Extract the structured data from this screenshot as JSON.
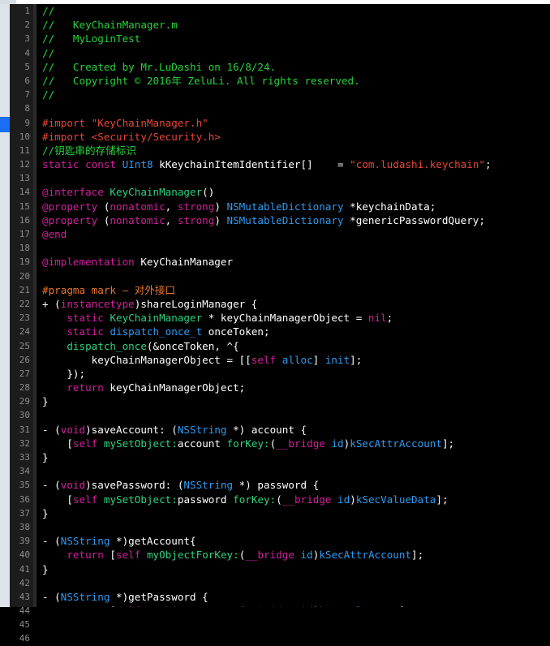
{
  "window": {
    "title": "KeyChainManager.m",
    "project": "MyLoginTest",
    "language": "Objective-C",
    "theme": "dark",
    "colors": {
      "background": "#000000",
      "gutter": "#1c1c1c",
      "line_number": "#8c8c8c",
      "ribbon": "#dfe4ea",
      "marker_blue": "#1a6ef5",
      "comment_green": "#29d13b",
      "preprocessor_red": "#e8463a",
      "string_red": "#e8463a",
      "keyword_magenta": "#d0219b",
      "type_blue": "#2f9bf0",
      "class_green": "#2ed17d",
      "selector_green": "#2ed17d",
      "pragma_orange": "#e8762a",
      "plain_white": "#ffffff"
    }
  },
  "gutter": {
    "line_numbers": [
      1,
      2,
      3,
      4,
      5,
      6,
      7,
      8,
      9,
      10,
      11,
      12,
      13,
      14,
      15,
      16,
      17,
      18,
      19,
      20,
      21,
      22,
      23,
      24,
      25,
      26,
      27,
      28,
      29,
      30,
      31,
      32,
      33,
      34,
      35,
      36,
      37,
      38,
      39,
      40,
      41,
      42,
      43,
      44,
      45,
      46
    ]
  },
  "code": {
    "lines": [
      {
        "n": 1,
        "tokens": [
          {
            "t": "//",
            "c": "t-com"
          }
        ]
      },
      {
        "n": 2,
        "tokens": [
          {
            "t": "//   KeyChainManager.m",
            "c": "t-com"
          }
        ]
      },
      {
        "n": 3,
        "tokens": [
          {
            "t": "//   MyLoginTest",
            "c": "t-com"
          }
        ]
      },
      {
        "n": 4,
        "tokens": [
          {
            "t": "//",
            "c": "t-com"
          }
        ]
      },
      {
        "n": 5,
        "tokens": [
          {
            "t": "//   Created by Mr.LuDashi on 16/8/24.",
            "c": "t-com"
          }
        ]
      },
      {
        "n": 6,
        "tokens": [
          {
            "t": "//   Copyright © 2016年 ZeluLi. All rights reserved.",
            "c": "t-com"
          }
        ]
      },
      {
        "n": 7,
        "tokens": [
          {
            "t": "//",
            "c": "t-com"
          }
        ]
      },
      {
        "n": 8,
        "tokens": []
      },
      {
        "n": 9,
        "tokens": [
          {
            "t": "#import ",
            "c": "t-pre"
          },
          {
            "t": "\"KeyChainManager.h\"",
            "c": "t-str"
          }
        ]
      },
      {
        "n": 10,
        "tokens": [
          {
            "t": "#import ",
            "c": "t-pre"
          },
          {
            "t": "<Security/Security.h>",
            "c": "t-str"
          }
        ]
      },
      {
        "n": 11,
        "tokens": [
          {
            "t": "//钥匙串的存储标识",
            "c": "t-com"
          }
        ]
      },
      {
        "n": 12,
        "tokens": [
          {
            "t": "static",
            "c": "t-kw"
          },
          {
            "t": " ",
            "c": "t-plain"
          },
          {
            "t": "const",
            "c": "t-kw"
          },
          {
            "t": " ",
            "c": "t-plain"
          },
          {
            "t": "UInt8",
            "c": "t-typ"
          },
          {
            "t": " kKeychainItemIdentifier[]    = ",
            "c": "t-plain"
          },
          {
            "t": "\"com.ludashi.keychain\"",
            "c": "t-str"
          },
          {
            "t": ";",
            "c": "t-plain"
          }
        ]
      },
      {
        "n": 13,
        "tokens": []
      },
      {
        "n": 14,
        "tokens": [
          {
            "t": "@interface",
            "c": "t-kw"
          },
          {
            "t": " ",
            "c": "t-plain"
          },
          {
            "t": "KeyChainManager",
            "c": "t-cls"
          },
          {
            "t": "()",
            "c": "t-plain"
          }
        ]
      },
      {
        "n": 15,
        "tokens": [
          {
            "t": "@property",
            "c": "t-kw"
          },
          {
            "t": " (",
            "c": "t-plain"
          },
          {
            "t": "nonatomic",
            "c": "t-kw"
          },
          {
            "t": ", ",
            "c": "t-plain"
          },
          {
            "t": "strong",
            "c": "t-kw"
          },
          {
            "t": ") ",
            "c": "t-plain"
          },
          {
            "t": "NSMutableDictionary",
            "c": "t-typ"
          },
          {
            "t": " *keychainData;",
            "c": "t-plain"
          }
        ]
      },
      {
        "n": 16,
        "tokens": [
          {
            "t": "@property",
            "c": "t-kw"
          },
          {
            "t": " (",
            "c": "t-plain"
          },
          {
            "t": "nonatomic",
            "c": "t-kw"
          },
          {
            "t": ", ",
            "c": "t-plain"
          },
          {
            "t": "strong",
            "c": "t-kw"
          },
          {
            "t": ") ",
            "c": "t-plain"
          },
          {
            "t": "NSMutableDictionary",
            "c": "t-typ"
          },
          {
            "t": " *genericPasswordQuery;",
            "c": "t-plain"
          }
        ]
      },
      {
        "n": 17,
        "tokens": [
          {
            "t": "@end",
            "c": "t-kw"
          }
        ]
      },
      {
        "n": 18,
        "tokens": []
      },
      {
        "n": 19,
        "tokens": [
          {
            "t": "@implementation",
            "c": "t-kw"
          },
          {
            "t": " KeyChainManager",
            "c": "t-plain"
          }
        ]
      },
      {
        "n": 20,
        "tokens": []
      },
      {
        "n": 21,
        "tokens": [
          {
            "t": "#pragma mark — 对外接口",
            "c": "t-prag"
          }
        ]
      },
      {
        "n": 22,
        "tokens": [
          {
            "t": "+ (",
            "c": "t-plain"
          },
          {
            "t": "instancetype",
            "c": "t-kw"
          },
          {
            "t": ")shareLoginManager {",
            "c": "t-plain"
          }
        ]
      },
      {
        "n": 23,
        "tokens": [
          {
            "t": "    ",
            "c": "t-plain"
          },
          {
            "t": "static",
            "c": "t-kw"
          },
          {
            "t": " ",
            "c": "t-plain"
          },
          {
            "t": "KeyChainManager",
            "c": "t-cls"
          },
          {
            "t": " * keyChainManagerObject = ",
            "c": "t-plain"
          },
          {
            "t": "nil",
            "c": "t-kw"
          },
          {
            "t": ";",
            "c": "t-plain"
          }
        ]
      },
      {
        "n": 24,
        "tokens": [
          {
            "t": "    ",
            "c": "t-plain"
          },
          {
            "t": "static",
            "c": "t-kw"
          },
          {
            "t": " ",
            "c": "t-plain"
          },
          {
            "t": "dispatch_once_t",
            "c": "t-typ"
          },
          {
            "t": " onceToken;",
            "c": "t-plain"
          }
        ]
      },
      {
        "n": 25,
        "tokens": [
          {
            "t": "    ",
            "c": "t-plain"
          },
          {
            "t": "dispatch_once",
            "c": "t-sel"
          },
          {
            "t": "(&onceToken, ^{",
            "c": "t-plain"
          }
        ]
      },
      {
        "n": 26,
        "tokens": [
          {
            "t": "        keyChainManagerObject = [[",
            "c": "t-plain"
          },
          {
            "t": "self",
            "c": "t-kw"
          },
          {
            "t": " ",
            "c": "t-plain"
          },
          {
            "t": "alloc",
            "c": "t-typ"
          },
          {
            "t": "] ",
            "c": "t-plain"
          },
          {
            "t": "init",
            "c": "t-typ"
          },
          {
            "t": "];",
            "c": "t-plain"
          }
        ]
      },
      {
        "n": 27,
        "tokens": [
          {
            "t": "    });",
            "c": "t-plain"
          }
        ]
      },
      {
        "n": 28,
        "tokens": [
          {
            "t": "    ",
            "c": "t-plain"
          },
          {
            "t": "return",
            "c": "t-kw"
          },
          {
            "t": " keyChainManagerObject;",
            "c": "t-plain"
          }
        ]
      },
      {
        "n": 29,
        "tokens": [
          {
            "t": "}",
            "c": "t-plain"
          }
        ]
      },
      {
        "n": 30,
        "tokens": []
      },
      {
        "n": 31,
        "tokens": [
          {
            "t": "- (",
            "c": "t-plain"
          },
          {
            "t": "void",
            "c": "t-kw"
          },
          {
            "t": ")saveAccount: (",
            "c": "t-plain"
          },
          {
            "t": "NSString",
            "c": "t-typ"
          },
          {
            "t": " *) account {",
            "c": "t-plain"
          }
        ]
      },
      {
        "n": 32,
        "tokens": [
          {
            "t": "    [",
            "c": "t-plain"
          },
          {
            "t": "self",
            "c": "t-kw"
          },
          {
            "t": " ",
            "c": "t-plain"
          },
          {
            "t": "mySetObject:",
            "c": "t-sel"
          },
          {
            "t": "account ",
            "c": "t-plain"
          },
          {
            "t": "forKey:",
            "c": "t-sel"
          },
          {
            "t": "(",
            "c": "t-plain"
          },
          {
            "t": "__bridge",
            "c": "t-kw"
          },
          {
            "t": " ",
            "c": "t-plain"
          },
          {
            "t": "id",
            "c": "t-typ"
          },
          {
            "t": ")",
            "c": "t-plain"
          },
          {
            "t": "kSecAttrAccount",
            "c": "t-typ"
          },
          {
            "t": "];",
            "c": "t-plain"
          }
        ]
      },
      {
        "n": 33,
        "tokens": [
          {
            "t": "}",
            "c": "t-plain"
          }
        ]
      },
      {
        "n": 34,
        "tokens": []
      },
      {
        "n": 35,
        "tokens": [
          {
            "t": "- (",
            "c": "t-plain"
          },
          {
            "t": "void",
            "c": "t-kw"
          },
          {
            "t": ")savePassword: (",
            "c": "t-plain"
          },
          {
            "t": "NSString",
            "c": "t-typ"
          },
          {
            "t": " *) password {",
            "c": "t-plain"
          }
        ]
      },
      {
        "n": 36,
        "tokens": [
          {
            "t": "    [",
            "c": "t-plain"
          },
          {
            "t": "self",
            "c": "t-kw"
          },
          {
            "t": " ",
            "c": "t-plain"
          },
          {
            "t": "mySetObject:",
            "c": "t-sel"
          },
          {
            "t": "password ",
            "c": "t-plain"
          },
          {
            "t": "forKey:",
            "c": "t-sel"
          },
          {
            "t": "(",
            "c": "t-plain"
          },
          {
            "t": "__bridge",
            "c": "t-kw"
          },
          {
            "t": " ",
            "c": "t-plain"
          },
          {
            "t": "id",
            "c": "t-typ"
          },
          {
            "t": ")",
            "c": "t-plain"
          },
          {
            "t": "kSecValueData",
            "c": "t-typ"
          },
          {
            "t": "];",
            "c": "t-plain"
          }
        ]
      },
      {
        "n": 37,
        "tokens": [
          {
            "t": "}",
            "c": "t-plain"
          }
        ]
      },
      {
        "n": 38,
        "tokens": []
      },
      {
        "n": 39,
        "tokens": [
          {
            "t": "- (",
            "c": "t-plain"
          },
          {
            "t": "NSString",
            "c": "t-typ"
          },
          {
            "t": " *)getAccount{",
            "c": "t-plain"
          }
        ]
      },
      {
        "n": 40,
        "tokens": [
          {
            "t": "    ",
            "c": "t-plain"
          },
          {
            "t": "return",
            "c": "t-kw"
          },
          {
            "t": " [",
            "c": "t-plain"
          },
          {
            "t": "self",
            "c": "t-kw"
          },
          {
            "t": " ",
            "c": "t-plain"
          },
          {
            "t": "myObjectForKey:",
            "c": "t-sel"
          },
          {
            "t": "(",
            "c": "t-plain"
          },
          {
            "t": "__bridge",
            "c": "t-kw"
          },
          {
            "t": " ",
            "c": "t-plain"
          },
          {
            "t": "id",
            "c": "t-typ"
          },
          {
            "t": ")",
            "c": "t-plain"
          },
          {
            "t": "kSecAttrAccount",
            "c": "t-typ"
          },
          {
            "t": "];",
            "c": "t-plain"
          }
        ]
      },
      {
        "n": 41,
        "tokens": [
          {
            "t": "}",
            "c": "t-plain"
          }
        ]
      },
      {
        "n": 42,
        "tokens": []
      },
      {
        "n": 43,
        "tokens": [
          {
            "t": "- (",
            "c": "t-plain"
          },
          {
            "t": "NSString",
            "c": "t-typ"
          },
          {
            "t": " *)getPassword {",
            "c": "t-plain"
          }
        ]
      },
      {
        "n": 44,
        "tokens": [
          {
            "t": "    ",
            "c": "t-plain"
          },
          {
            "t": "return",
            "c": "t-kw"
          },
          {
            "t": " [",
            "c": "t-plain"
          },
          {
            "t": "self",
            "c": "t-kw"
          },
          {
            "t": " ",
            "c": "t-plain"
          },
          {
            "t": "myObjectForKey:",
            "c": "t-sel"
          },
          {
            "t": "(",
            "c": "t-plain"
          },
          {
            "t": "__bridge",
            "c": "t-kw"
          },
          {
            "t": " ",
            "c": "t-plain"
          },
          {
            "t": "id",
            "c": "t-typ"
          },
          {
            "t": ")",
            "c": "t-plain"
          },
          {
            "t": "kSecValueData",
            "c": "t-typ"
          },
          {
            "t": "];",
            "c": "t-plain"
          }
        ]
      },
      {
        "n": 45,
        "tokens": [
          {
            "t": "}",
            "c": "t-plain"
          }
        ]
      },
      {
        "n": 46,
        "tokens": []
      }
    ]
  }
}
